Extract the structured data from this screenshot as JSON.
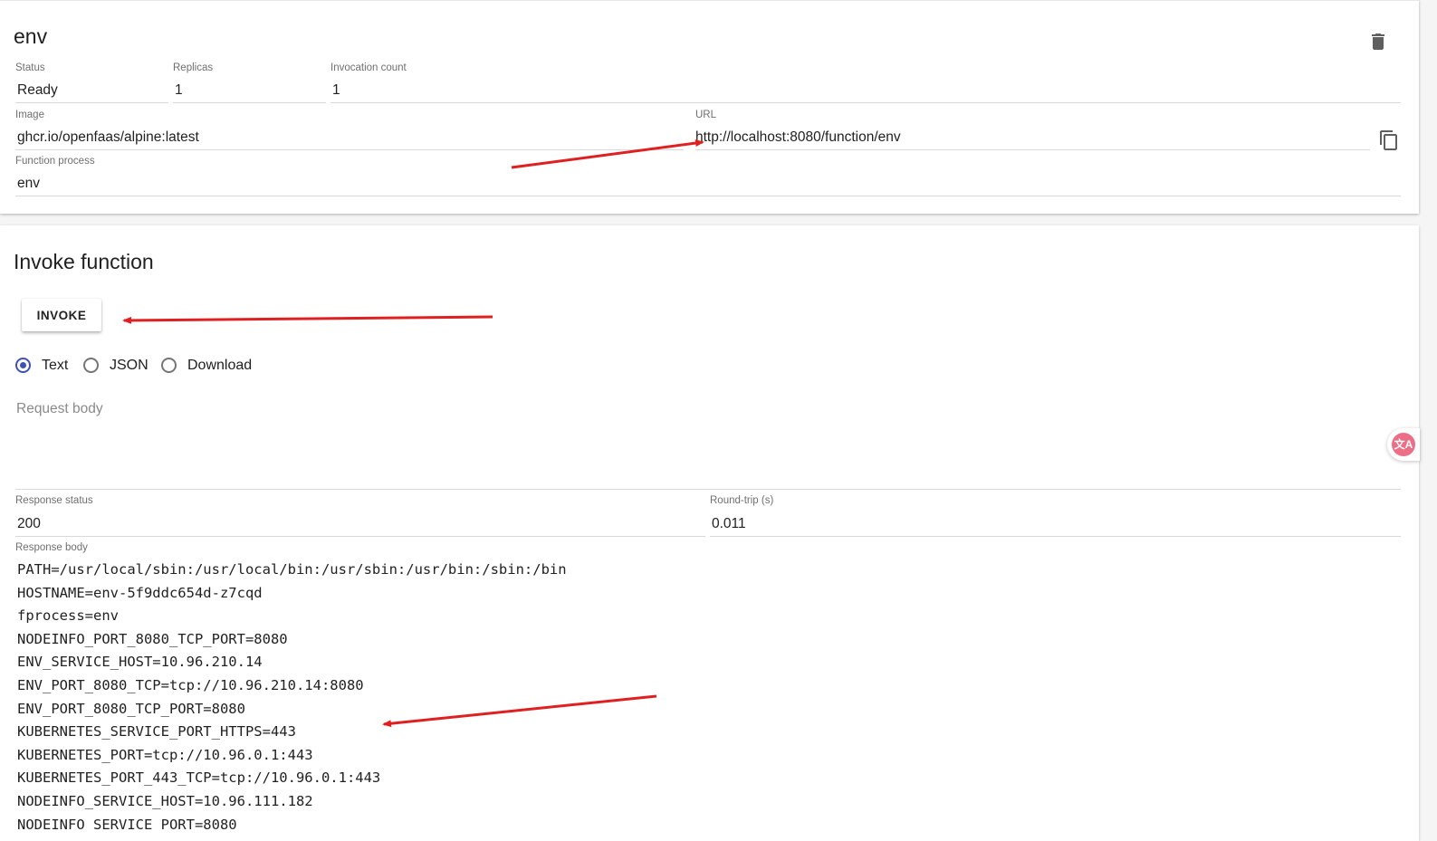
{
  "function": {
    "name": "env",
    "status_label": "Status",
    "status": "Ready",
    "replicas_label": "Replicas",
    "replicas": "1",
    "invocation_count_label": "Invocation count",
    "invocation_count": "1",
    "image_label": "Image",
    "image": "ghcr.io/openfaas/alpine:latest",
    "url_label": "URL",
    "url": "http://localhost:8080/function/env",
    "process_label": "Function process",
    "process": "env"
  },
  "invoke": {
    "title": "Invoke function",
    "button_label": "INVOKE",
    "content_types": [
      {
        "label": "Text",
        "selected": true
      },
      {
        "label": "JSON",
        "selected": false
      },
      {
        "label": "Download",
        "selected": false
      }
    ],
    "request_body_placeholder": "Request body",
    "response_status_label": "Response status",
    "response_status": "200",
    "round_trip_label": "Round-trip (s)",
    "round_trip": "0.011",
    "response_body_label": "Response body",
    "response_body_lines": [
      "PATH=/usr/local/sbin:/usr/local/bin:/usr/sbin:/usr/bin:/sbin:/bin",
      "HOSTNAME=env-5f9ddc654d-z7cqd",
      "fprocess=env",
      "NODEINFO_PORT_8080_TCP_PORT=8080",
      "ENV_SERVICE_HOST=10.96.210.14",
      "ENV_PORT_8080_TCP=tcp://10.96.210.14:8080",
      "ENV_PORT_8080_TCP_PORT=8080",
      "KUBERNETES_SERVICE_PORT_HTTPS=443",
      "KUBERNETES_PORT=tcp://10.96.0.1:443",
      "KUBERNETES_PORT_443_TCP=tcp://10.96.0.1:443",
      "NODEINFO_SERVICE_HOST=10.96.111.182",
      "NODEINFO_SERVICE_PORT=8080"
    ]
  },
  "icons": {
    "delete": "trash-icon",
    "copy": "copy-icon",
    "translate": "translate-icon"
  },
  "translate_badge_text": "文A",
  "colors": {
    "accent": "#3f51b5",
    "annotation_arrow": "#e02020",
    "translate_badge": "#ec6f86"
  }
}
